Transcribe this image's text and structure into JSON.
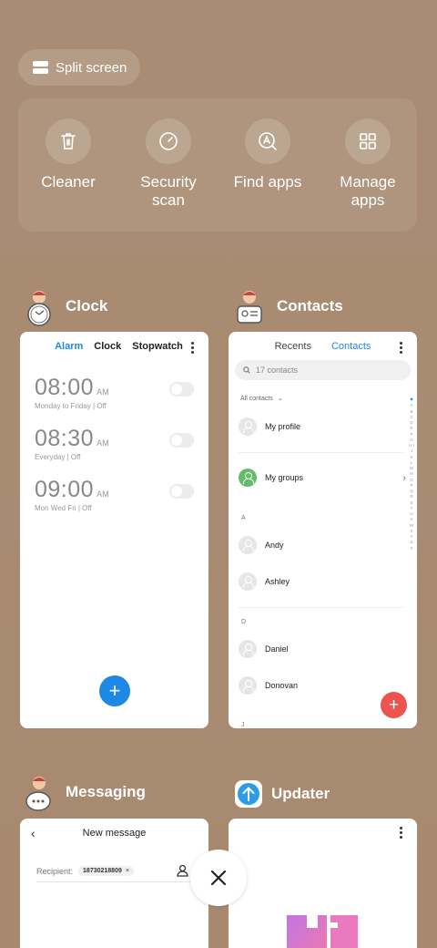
{
  "split_screen": {
    "label": "Split screen"
  },
  "quick_actions": [
    {
      "label": "Cleaner",
      "icon": "trash-icon"
    },
    {
      "label": "Security scan",
      "icon": "gauge-icon"
    },
    {
      "label": "Find apps",
      "icon": "search-app-icon"
    },
    {
      "label": "Manage apps",
      "icon": "grid-icon"
    }
  ],
  "apps": {
    "clock": {
      "title": "Clock",
      "tabs": [
        "Alarm",
        "Clock",
        "Stopwatch"
      ],
      "active_tab": "Alarm",
      "alarms": [
        {
          "time": "08:00",
          "ampm": "AM",
          "sub": "Monday to Friday | Off",
          "enabled": false
        },
        {
          "time": "08:30",
          "ampm": "AM",
          "sub": "Everyday | Off",
          "enabled": false
        },
        {
          "time": "09:00",
          "ampm": "AM",
          "sub": "Mon Wed Fri | Off",
          "enabled": false
        }
      ],
      "fab": "+"
    },
    "contacts": {
      "title": "Contacts",
      "tabs": [
        "Recents",
        "Contacts"
      ],
      "active_tab": "Contacts",
      "search_placeholder": "17 contacts",
      "filter": "All contacts",
      "rows": {
        "profile": "My profile",
        "groups": "My groups",
        "section_a": "A",
        "andy": "Andy",
        "ashley": "Ashley",
        "section_d": "D",
        "daniel": "Daniel",
        "donovan": "Donovan",
        "section_j": "J"
      },
      "alphabet": "A B C D E F G H I J K L M N O P Q R S T U V W X Y Z #"
    },
    "messaging": {
      "title": "Messaging",
      "header": "New message",
      "recipient_label": "Recipient:",
      "recipient_value": "18730218809",
      "chip_remove": "×"
    },
    "updater": {
      "title": "Updater"
    }
  },
  "close_button": {
    "label": "×"
  },
  "colors": {
    "background": "#a88a72",
    "accent_blue": "#1e88e5",
    "contacts_fab": "#ef5350",
    "groups_green": "#66bb6a"
  }
}
